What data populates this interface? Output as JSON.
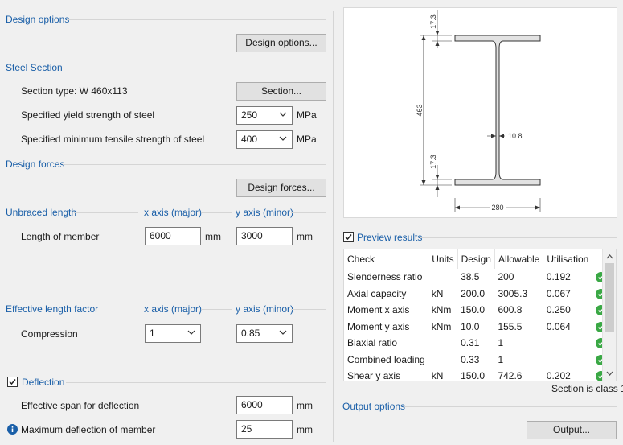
{
  "design_options": {
    "header": "Design options",
    "button": "Design options..."
  },
  "steel_section": {
    "header": "Steel Section",
    "section_type": "Section type: W 460x113",
    "section_button": "Section...",
    "yield_label": "Specified yield strength of steel",
    "yield_value": "250",
    "yield_unit": "MPa",
    "tensile_label": "Specified minimum tensile strength of steel",
    "tensile_value": "400",
    "tensile_unit": "MPa"
  },
  "design_forces": {
    "header": "Design forces",
    "button": "Design forces..."
  },
  "unbraced_length": {
    "header": "Unbraced length",
    "x_axis": "x axis (major)",
    "y_axis": "y axis (minor)",
    "row_label": "Length of member",
    "x_value": "6000",
    "y_value": "3000",
    "unit": "mm"
  },
  "effective_length_factor": {
    "header": "Effective length factor",
    "x_axis": "x axis (major)",
    "y_axis": "y axis (minor)",
    "row_label": "Compression",
    "x_value": "1",
    "y_value": "0.85"
  },
  "deflection": {
    "header": "Deflection",
    "checked": true,
    "span_label": "Effective span for deflection",
    "span_value": "6000",
    "span_unit": "mm",
    "max_label": "Maximum deflection of member",
    "max_value": "25",
    "max_unit": "mm"
  },
  "section_preview": {
    "depth": "463",
    "flange_thickness_top": "17.3",
    "flange_thickness_bottom": "17.3",
    "web_thickness": "10.8",
    "flange_width": "280"
  },
  "preview_results": {
    "header": "Preview results",
    "checked": true,
    "columns": [
      "Check",
      "Units",
      "Design",
      "Allowable",
      "Utilisation"
    ],
    "rows": [
      [
        "Slenderness ratio",
        "",
        "38.5",
        "200",
        "0.192"
      ],
      [
        "Axial capacity",
        "kN",
        "200.0",
        "3005.3",
        "0.067"
      ],
      [
        "Moment x axis",
        "kNm",
        "150.0",
        "600.8",
        "0.250"
      ],
      [
        "Moment y axis",
        "kNm",
        "10.0",
        "155.5",
        "0.064"
      ],
      [
        "Biaxial ratio",
        "",
        "0.31",
        "1",
        ""
      ],
      [
        "Combined loading",
        "",
        "0.33",
        "1",
        ""
      ],
      [
        "Shear y axis",
        "kN",
        "150.0",
        "742.6",
        "0.202"
      ]
    ],
    "class_note": "Section is class 1"
  },
  "output_options": {
    "header": "Output options",
    "button": "Output..."
  },
  "colors": {
    "header_blue": "#1a5fa8",
    "ok_green": "#3aa845"
  }
}
